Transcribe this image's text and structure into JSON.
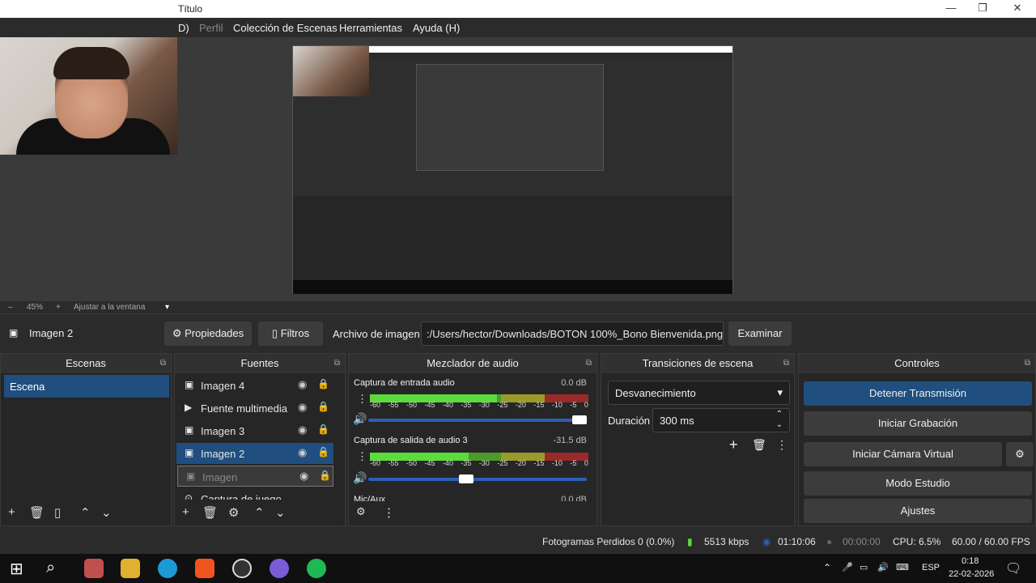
{
  "window": {
    "title": "Título"
  },
  "menu": {
    "items": [
      "D)",
      "Perfil",
      "Colección de Escenas",
      "Herramientas",
      "Ayuda (H)"
    ]
  },
  "zoom": {
    "minus": "–",
    "level": "45%",
    "plus": "+",
    "fit": "Ajustar a la ventana",
    "dropdown": "▾"
  },
  "source_bar": {
    "selected": "Imagen 2",
    "properties": "Propiedades",
    "filters": "Filtros",
    "file_label": "Archivo de imagen",
    "file_path": ":/Users/hector/Downloads/BOTON 100%_Bono Bienvenida.png",
    "browse": "Examinar"
  },
  "scenes": {
    "title": "Escenas",
    "items": [
      "Escena"
    ]
  },
  "sources": {
    "title": "Fuentes",
    "items": [
      "Imagen 4",
      "Fuente multimedia",
      "Imagen 3",
      "Imagen 2",
      "Imagen",
      "Captura de juego"
    ]
  },
  "mixer": {
    "title": "Mezclador de audio",
    "channels": [
      {
        "name": "Captura de entrada audio",
        "db": "0.0 dB"
      },
      {
        "name": "Captura de salida de audio 3",
        "db": "-31.5 dB"
      },
      {
        "name": "Mic/Aux",
        "db": "0.0 dB"
      }
    ],
    "scale": [
      "-60",
      "-55",
      "-50",
      "-45",
      "-40",
      "-35",
      "-30",
      "-25",
      "-20",
      "-15",
      "-10",
      "-5",
      "0"
    ]
  },
  "transitions": {
    "title": "Transiciones de escena",
    "type": "Desvanecimiento",
    "duration_label": "Duración",
    "duration": "300 ms"
  },
  "controls": {
    "title": "Controles",
    "stop_stream": "Detener Transmisión",
    "start_record": "Iniciar Grabación",
    "virtual_cam": "Iniciar Cámara Virtual",
    "studio": "Modo Estudio",
    "settings": "Ajustes"
  },
  "status": {
    "dropped": "Fotogramas Perdidos 0 (0.0%)",
    "bitrate": "5513 kbps",
    "live_time": "01:10:06",
    "rec_time": "00:00:00",
    "cpu": "CPU: 6.5%",
    "fps": "60.00 / 60.00 FPS"
  },
  "taskbar": {
    "lang": "ESP",
    "time": "0:18",
    "date": "22-02-2026"
  },
  "colors": {
    "accent": "#1f4e7f",
    "meter_green": "#5cdc3a",
    "volume_blue": "#2c5fb8"
  }
}
